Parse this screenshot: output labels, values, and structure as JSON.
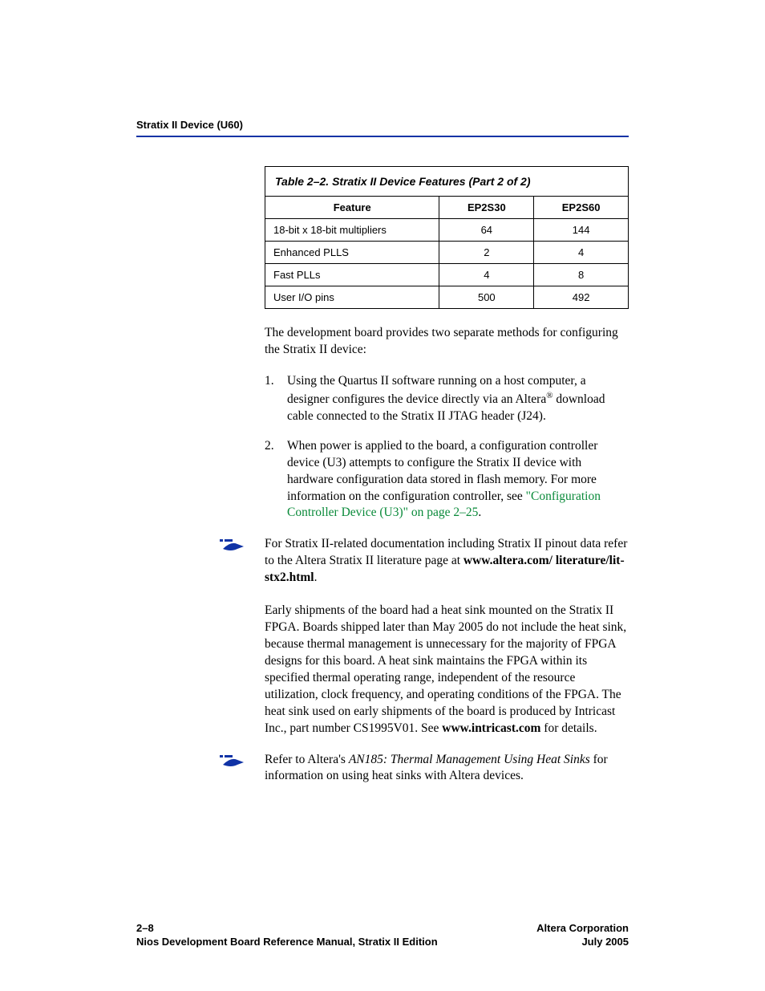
{
  "header": {
    "section": "Stratix II Device (U60)"
  },
  "table": {
    "title": "Table 2–2. Stratix II Device Features  (Part 2 of 2)",
    "cols": {
      "feature": "Feature",
      "c1": "EP2S30",
      "c2": "EP2S60"
    },
    "rows": [
      {
        "feature": "18-bit x 18-bit multipliers",
        "c1": "64",
        "c2": "144"
      },
      {
        "feature": "Enhanced PLLS",
        "c1": "2",
        "c2": "4"
      },
      {
        "feature": "Fast PLLs",
        "c1": "4",
        "c2": "8"
      },
      {
        "feature": "User I/O pins",
        "c1": "500",
        "c2": "492"
      }
    ]
  },
  "body": {
    "intro": "The development board provides two separate methods for configuring the Stratix II device:",
    "step1_pre": "Using the Quartus II software running on a host computer, a designer configures the device directly via an Altera",
    "step1_post": " download cable connected to the Stratix II JTAG header (J24).",
    "step2_pre": "When power is applied to the board, a configuration controller device (U3) attempts to configure the Stratix II device with hardware configuration data stored in flash memory. For more information on the configuration controller, see ",
    "step2_link": "\"Configuration Controller Device (U3)\" on page 2–25",
    "step2_post": ".",
    "ref1_pre": "For Stratix II-related documentation including Stratix II pinout data refer to the Altera Stratix II literature page at ",
    "ref1_bold": "www.altera.com/ literature/lit-stx2.html",
    "ref1_post": ".",
    "heat": "Early shipments of the board had a heat sink mounted on the Stratix II FPGA. Boards shipped later than May 2005 do not include the heat sink, because thermal management is unnecessary for the majority of FPGA designs for this board. A heat sink maintains the FPGA within its specified thermal operating range, independent of the resource utilization, clock frequency, and operating conditions of the FPGA. The heat sink used on early shipments of the board is produced by Intricast Inc., part number CS1995V01. See ",
    "heat_bold": "www.intricast.com",
    "heat_post": " for details.",
    "ref2_pre": "Refer to Altera's ",
    "ref2_ital": "AN185: Thermal Management Using Heat Sinks",
    "ref2_post": " for information on using heat sinks with Altera devices."
  },
  "footer": {
    "page": "2–8",
    "manual": "Nios Development Board Reference Manual, Stratix II Edition",
    "corp": "Altera Corporation",
    "date": "July 2005"
  },
  "list": {
    "n1": "1.",
    "n2": "2."
  },
  "reg": "®"
}
